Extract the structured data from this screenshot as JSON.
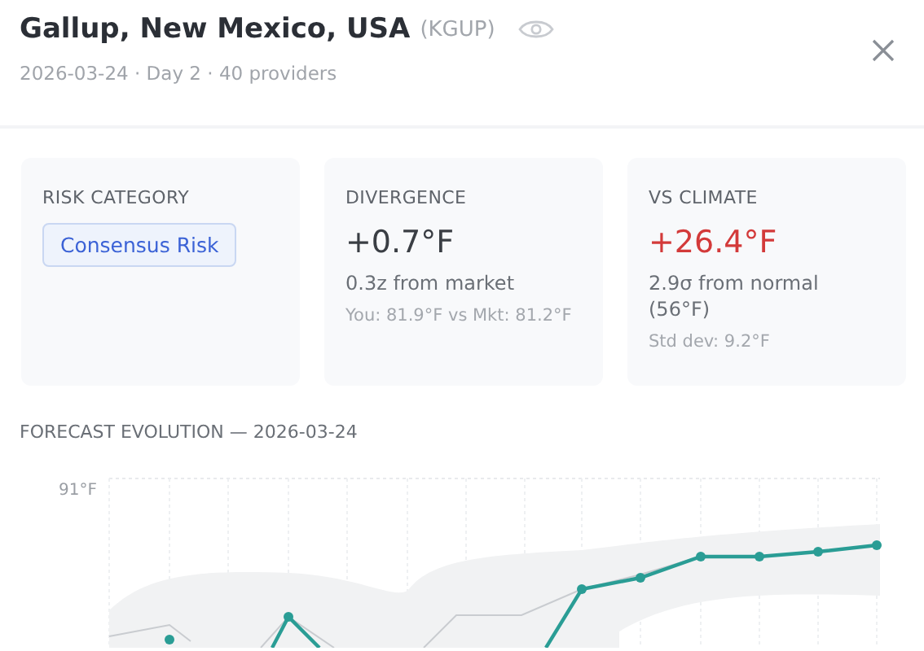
{
  "header": {
    "title": "Gallup, New Mexico, USA",
    "code": "(KGUP)",
    "subtitle": "2026-03-24 · Day 2 · 40 providers"
  },
  "cards": [
    {
      "kind": "badge",
      "label": "RISK CATEGORY",
      "badge": "Consensus Risk"
    },
    {
      "kind": "metric",
      "label": "DIVERGENCE",
      "value": "+0.7°F",
      "alert": false,
      "detail": "0.3z from market",
      "note": "You: 81.9°F vs Mkt: 81.2°F"
    },
    {
      "kind": "metric",
      "label": "VS CLIMATE",
      "value": "+26.4°F",
      "alert": true,
      "detail": "2.9σ from normal (56°F)",
      "note": "Std dev: 9.2°F"
    }
  ],
  "chart": {
    "title": "FORECAST EVOLUTION — 2026-03-24",
    "y_top_label": "91°F"
  }
}
